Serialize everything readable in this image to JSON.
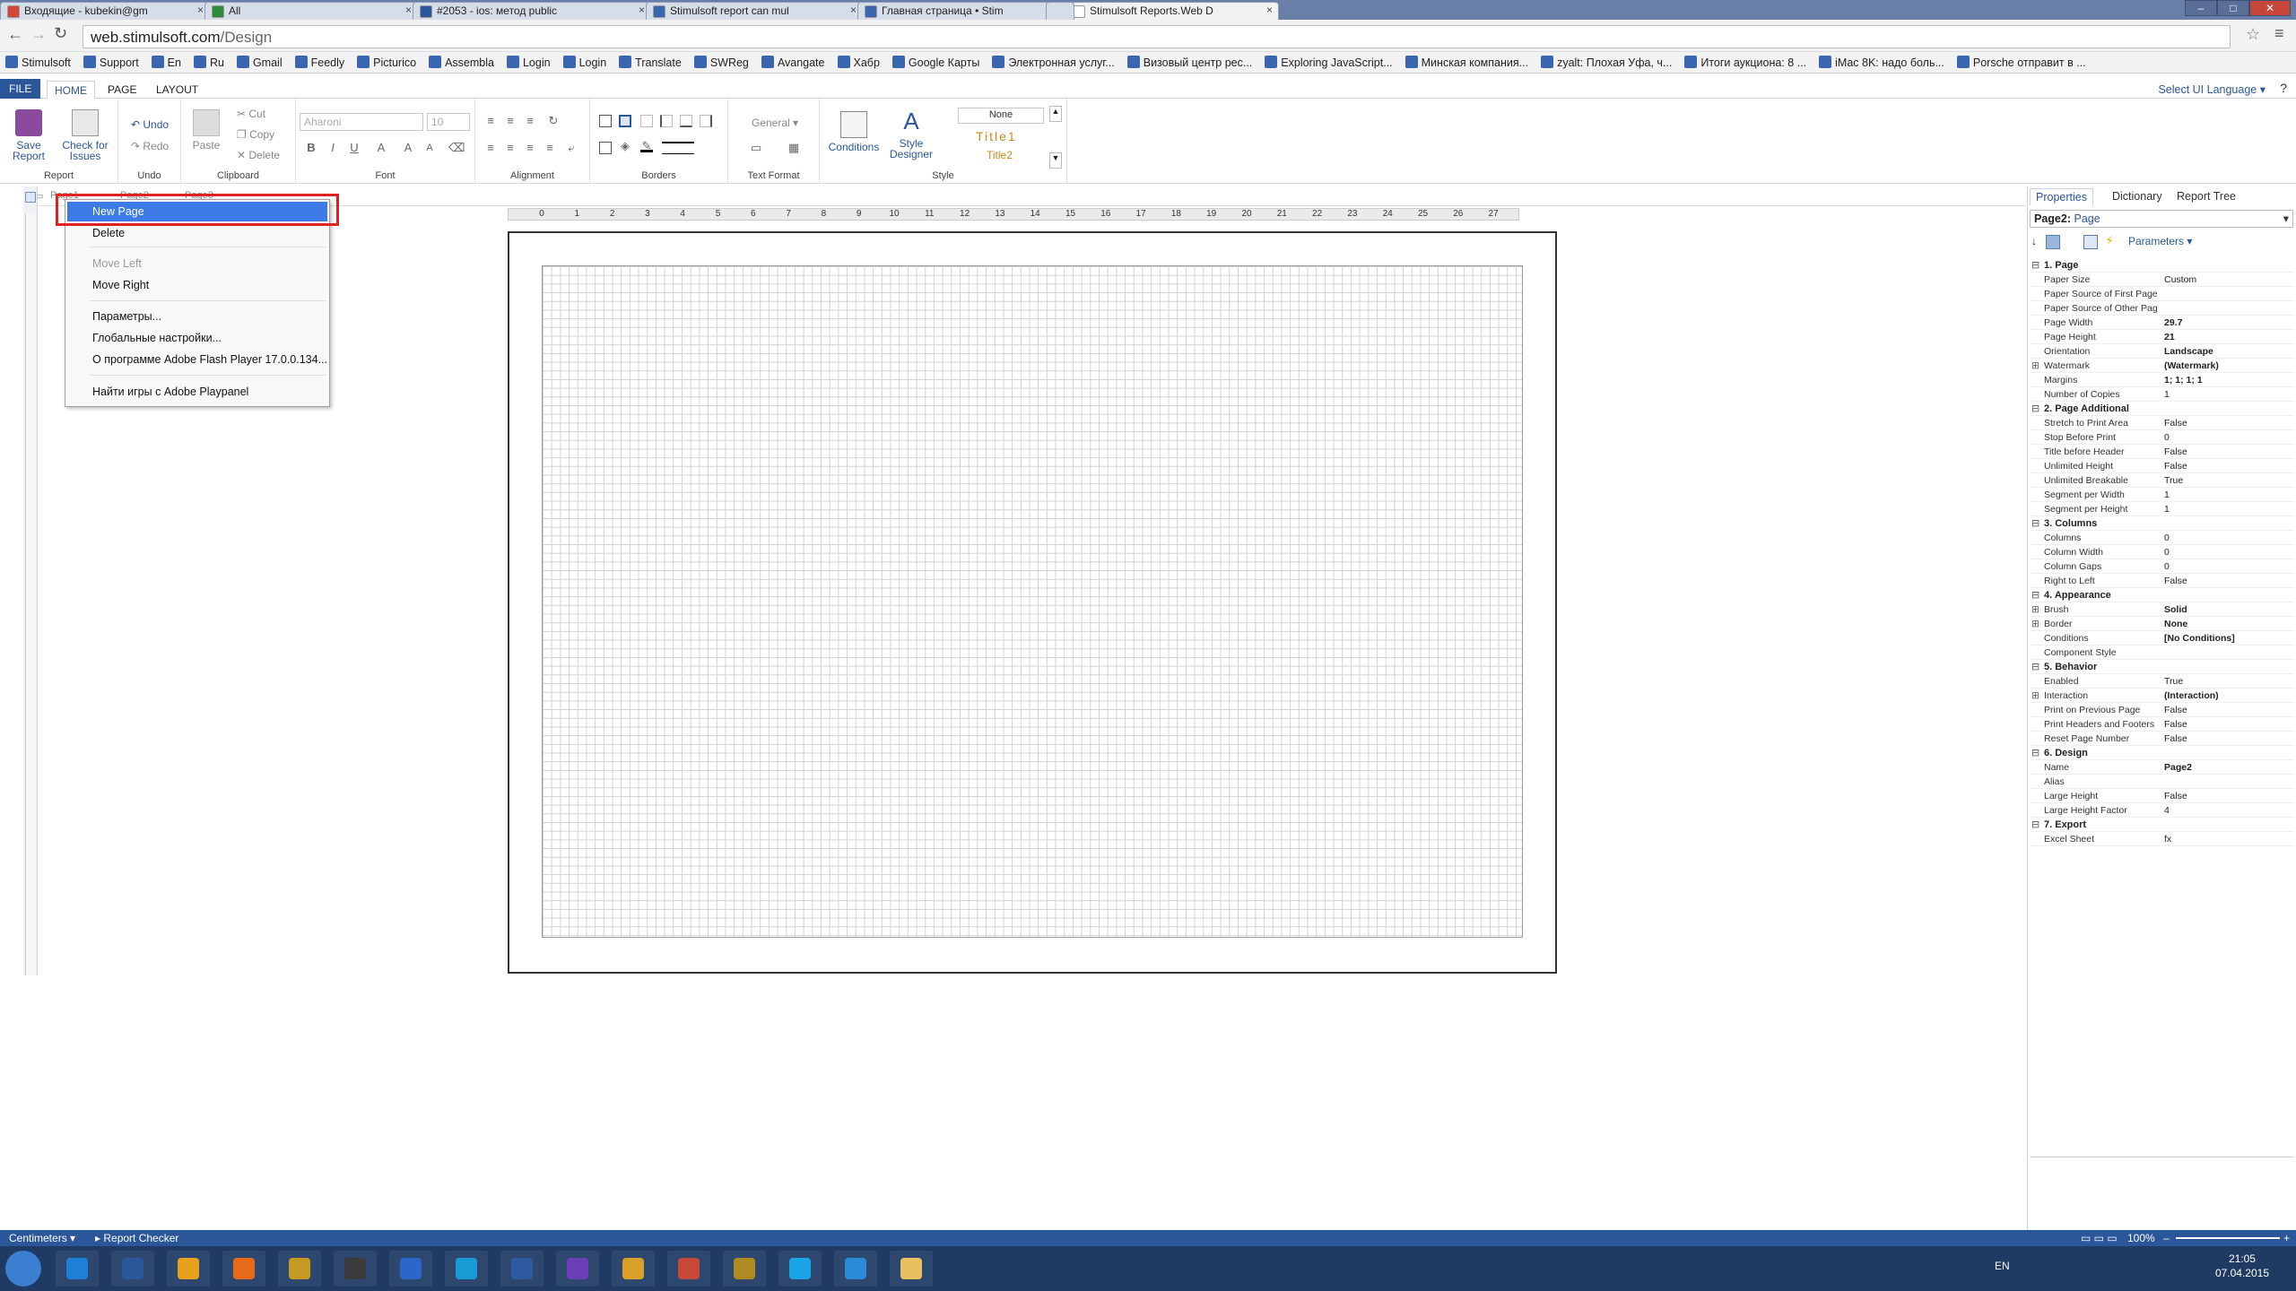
{
  "browser": {
    "tabs": [
      {
        "title": "Входящие - kubekin@gm",
        "fav": "#d44638"
      },
      {
        "title": "All",
        "fav": "#2e8b3d"
      },
      {
        "title": "#2053 - ios: метод public",
        "fav": "#2b579a"
      },
      {
        "title": "Stimulsoft report can mul",
        "fav": "#3a66b0"
      },
      {
        "title": "Главная страница • Stim",
        "fav": "#3a66b0"
      },
      {
        "title": "Stimulsoft Reports.Web D",
        "fav": "#ffffff"
      }
    ],
    "url_domain": "web.stimulsoft.com",
    "url_path": "/Design",
    "bookmarks": [
      "Stimulsoft",
      "Support",
      "En",
      "Ru",
      "Gmail",
      "Feedly",
      "Picturico",
      "Assembla",
      "Login",
      "Login",
      "Translate",
      "SWReg",
      "Avangate",
      "Хабр",
      "Google Карты",
      "Электронная услуг...",
      "Визовый центр рес...",
      "Exploring JavaScript...",
      "Минская компания...",
      "zyalt: Плохая Уфа, ч...",
      "Итоги аукциона: 8 ...",
      "iMac 8K: надо боль...",
      "Porsche отправит в ..."
    ]
  },
  "ribbon": {
    "file": "FILE",
    "tabs": [
      "HOME",
      "PAGE",
      "LAYOUT"
    ],
    "lang": "Select UI Language",
    "help": "?",
    "save": "Save Report",
    "check": "Check for Issues",
    "undo": "Undo",
    "redo": "Redo",
    "paste": "Paste",
    "cut": "Cut",
    "copy": "Copy",
    "delete": "Delete",
    "font_name": "Aharoni",
    "font_size": "10",
    "format": "General",
    "conditions": "Conditions",
    "style_designer": "Style Designer",
    "style_none": "None",
    "style_title1": "Title1",
    "style_title2": "Title2",
    "groups": {
      "report": "Report",
      "undo": "Undo",
      "clipboard": "Clipboard",
      "font": "Font",
      "alignment": "Alignment",
      "borders": "Borders",
      "textformat": "Text Format",
      "style": "Style"
    }
  },
  "pages": {
    "tab1": "Page1",
    "tab2": "Page2",
    "tab3": "Page3"
  },
  "ruler": [
    "0",
    "1",
    "2",
    "3",
    "4",
    "5",
    "6",
    "7",
    "8",
    "9",
    "10",
    "11",
    "12",
    "13",
    "14",
    "15",
    "16",
    "17",
    "18",
    "19",
    "20",
    "21",
    "22",
    "23",
    "24",
    "25",
    "26",
    "27"
  ],
  "context_menu": {
    "new_page": "New Page",
    "delete": "Delete",
    "move_left": "Move Left",
    "move_right": "Move Right",
    "params": "Параметры...",
    "global": "Глобальные настройки...",
    "about": "О программе Adobe Flash Player 17.0.0.134...",
    "playpanel": "Найти игры с Adobe Playpanel"
  },
  "panel": {
    "tabs": [
      "Properties",
      "Dictionary",
      "Report Tree"
    ],
    "object_name": "Page2:",
    "object_type": "Page",
    "parameters": "Parameters",
    "categories": [
      {
        "name": "1. Page",
        "rows": [
          [
            "Paper Size",
            "Custom",
            ""
          ],
          [
            "Paper Source of First Page",
            "",
            ""
          ],
          [
            "Paper Source of Other Pages",
            "",
            ""
          ],
          [
            "Page Width",
            "29.7",
            "b"
          ],
          [
            "Page Height",
            "21",
            "b"
          ],
          [
            "Orientation",
            "Landscape",
            "b"
          ],
          [
            "Watermark",
            "(Watermark)",
            "b+"
          ],
          [
            "Margins",
            "1; 1; 1; 1",
            "b"
          ],
          [
            "Number of Copies",
            "1",
            ""
          ]
        ]
      },
      {
        "name": "2. Page Additional",
        "rows": [
          [
            "Stretch to Print Area",
            "False",
            ""
          ],
          [
            "Stop Before Print",
            "0",
            ""
          ],
          [
            "Title before Header",
            "False",
            ""
          ],
          [
            "Unlimited Height",
            "False",
            ""
          ],
          [
            "Unlimited Breakable",
            "True",
            ""
          ],
          [
            "Segment per Width",
            "1",
            ""
          ],
          [
            "Segment per Height",
            "1",
            ""
          ]
        ]
      },
      {
        "name": "3. Columns",
        "rows": [
          [
            "Columns",
            "0",
            ""
          ],
          [
            "Column Width",
            "0",
            ""
          ],
          [
            "Column Gaps",
            "0",
            ""
          ],
          [
            "Right to Left",
            "False",
            ""
          ]
        ]
      },
      {
        "name": "4. Appearance",
        "rows": [
          [
            "Brush",
            "Solid",
            "b+"
          ],
          [
            "Border",
            "None",
            "b+"
          ],
          [
            "Conditions",
            "[No Conditions]",
            "b"
          ],
          [
            "Component Style",
            "",
            ""
          ]
        ]
      },
      {
        "name": "5. Behavior",
        "rows": [
          [
            "Enabled",
            "True",
            ""
          ],
          [
            "Interaction",
            "(Interaction)",
            "b+"
          ],
          [
            "Print on Previous Page",
            "False",
            ""
          ],
          [
            "Print Headers and Footers",
            "False",
            ""
          ],
          [
            "Reset Page Number",
            "False",
            ""
          ]
        ]
      },
      {
        "name": "6. Design",
        "rows": [
          [
            "Name",
            "Page2",
            "b"
          ],
          [
            "Alias",
            "",
            ""
          ],
          [
            "Large Height",
            "False",
            ""
          ],
          [
            "Large Height Factor",
            "4",
            ""
          ]
        ]
      },
      {
        "name": "7. Export",
        "rows": [
          [
            "Excel Sheet",
            "fx",
            ""
          ]
        ]
      }
    ]
  },
  "status": {
    "units": "Centimeters",
    "checker": "Report Checker",
    "zoom": "100%"
  },
  "taskbar": {
    "lang": "EN",
    "time": "21:05",
    "date": "07.04.2015"
  },
  "colors": {
    "accent": "#2b579a",
    "highlight": "#3d7ae6",
    "annotation": "#e12020"
  }
}
